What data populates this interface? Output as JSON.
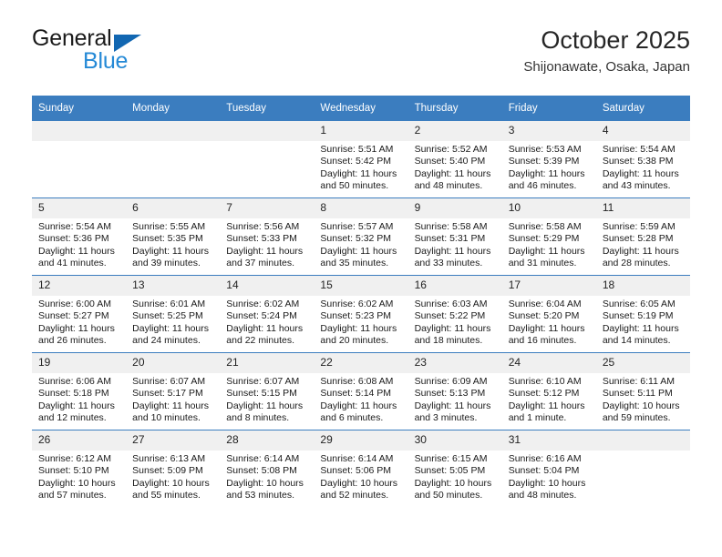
{
  "brand": {
    "name_top": "General",
    "name_bottom": "Blue",
    "accent_color": "#2489d6",
    "triangle_color": "#1267b2"
  },
  "header": {
    "title": "October 2025",
    "subtitle": "Shijonawate, Osaka, Japan"
  },
  "calendar": {
    "header_bg": "#3b7dbf",
    "daynum_bg": "#f0f0f0",
    "weekdays": [
      "Sunday",
      "Monday",
      "Tuesday",
      "Wednesday",
      "Thursday",
      "Friday",
      "Saturday"
    ],
    "labels": {
      "sunrise": "Sunrise:",
      "sunset": "Sunset:",
      "daylight": "Daylight:"
    },
    "weeks": [
      [
        {
          "day": "",
          "empty": true
        },
        {
          "day": "",
          "empty": true
        },
        {
          "day": "",
          "empty": true
        },
        {
          "day": "1",
          "sunrise": "Sunrise: 5:51 AM",
          "sunset": "Sunset: 5:42 PM",
          "daylight": "Daylight: 11 hours and 50 minutes."
        },
        {
          "day": "2",
          "sunrise": "Sunrise: 5:52 AM",
          "sunset": "Sunset: 5:40 PM",
          "daylight": "Daylight: 11 hours and 48 minutes."
        },
        {
          "day": "3",
          "sunrise": "Sunrise: 5:53 AM",
          "sunset": "Sunset: 5:39 PM",
          "daylight": "Daylight: 11 hours and 46 minutes."
        },
        {
          "day": "4",
          "sunrise": "Sunrise: 5:54 AM",
          "sunset": "Sunset: 5:38 PM",
          "daylight": "Daylight: 11 hours and 43 minutes."
        }
      ],
      [
        {
          "day": "5",
          "sunrise": "Sunrise: 5:54 AM",
          "sunset": "Sunset: 5:36 PM",
          "daylight": "Daylight: 11 hours and 41 minutes."
        },
        {
          "day": "6",
          "sunrise": "Sunrise: 5:55 AM",
          "sunset": "Sunset: 5:35 PM",
          "daylight": "Daylight: 11 hours and 39 minutes."
        },
        {
          "day": "7",
          "sunrise": "Sunrise: 5:56 AM",
          "sunset": "Sunset: 5:33 PM",
          "daylight": "Daylight: 11 hours and 37 minutes."
        },
        {
          "day": "8",
          "sunrise": "Sunrise: 5:57 AM",
          "sunset": "Sunset: 5:32 PM",
          "daylight": "Daylight: 11 hours and 35 minutes."
        },
        {
          "day": "9",
          "sunrise": "Sunrise: 5:58 AM",
          "sunset": "Sunset: 5:31 PM",
          "daylight": "Daylight: 11 hours and 33 minutes."
        },
        {
          "day": "10",
          "sunrise": "Sunrise: 5:58 AM",
          "sunset": "Sunset: 5:29 PM",
          "daylight": "Daylight: 11 hours and 31 minutes."
        },
        {
          "day": "11",
          "sunrise": "Sunrise: 5:59 AM",
          "sunset": "Sunset: 5:28 PM",
          "daylight": "Daylight: 11 hours and 28 minutes."
        }
      ],
      [
        {
          "day": "12",
          "sunrise": "Sunrise: 6:00 AM",
          "sunset": "Sunset: 5:27 PM",
          "daylight": "Daylight: 11 hours and 26 minutes."
        },
        {
          "day": "13",
          "sunrise": "Sunrise: 6:01 AM",
          "sunset": "Sunset: 5:25 PM",
          "daylight": "Daylight: 11 hours and 24 minutes."
        },
        {
          "day": "14",
          "sunrise": "Sunrise: 6:02 AM",
          "sunset": "Sunset: 5:24 PM",
          "daylight": "Daylight: 11 hours and 22 minutes."
        },
        {
          "day": "15",
          "sunrise": "Sunrise: 6:02 AM",
          "sunset": "Sunset: 5:23 PM",
          "daylight": "Daylight: 11 hours and 20 minutes."
        },
        {
          "day": "16",
          "sunrise": "Sunrise: 6:03 AM",
          "sunset": "Sunset: 5:22 PM",
          "daylight": "Daylight: 11 hours and 18 minutes."
        },
        {
          "day": "17",
          "sunrise": "Sunrise: 6:04 AM",
          "sunset": "Sunset: 5:20 PM",
          "daylight": "Daylight: 11 hours and 16 minutes."
        },
        {
          "day": "18",
          "sunrise": "Sunrise: 6:05 AM",
          "sunset": "Sunset: 5:19 PM",
          "daylight": "Daylight: 11 hours and 14 minutes."
        }
      ],
      [
        {
          "day": "19",
          "sunrise": "Sunrise: 6:06 AM",
          "sunset": "Sunset: 5:18 PM",
          "daylight": "Daylight: 11 hours and 12 minutes."
        },
        {
          "day": "20",
          "sunrise": "Sunrise: 6:07 AM",
          "sunset": "Sunset: 5:17 PM",
          "daylight": "Daylight: 11 hours and 10 minutes."
        },
        {
          "day": "21",
          "sunrise": "Sunrise: 6:07 AM",
          "sunset": "Sunset: 5:15 PM",
          "daylight": "Daylight: 11 hours and 8 minutes."
        },
        {
          "day": "22",
          "sunrise": "Sunrise: 6:08 AM",
          "sunset": "Sunset: 5:14 PM",
          "daylight": "Daylight: 11 hours and 6 minutes."
        },
        {
          "day": "23",
          "sunrise": "Sunrise: 6:09 AM",
          "sunset": "Sunset: 5:13 PM",
          "daylight": "Daylight: 11 hours and 3 minutes."
        },
        {
          "day": "24",
          "sunrise": "Sunrise: 6:10 AM",
          "sunset": "Sunset: 5:12 PM",
          "daylight": "Daylight: 11 hours and 1 minute."
        },
        {
          "day": "25",
          "sunrise": "Sunrise: 6:11 AM",
          "sunset": "Sunset: 5:11 PM",
          "daylight": "Daylight: 10 hours and 59 minutes."
        }
      ],
      [
        {
          "day": "26",
          "sunrise": "Sunrise: 6:12 AM",
          "sunset": "Sunset: 5:10 PM",
          "daylight": "Daylight: 10 hours and 57 minutes."
        },
        {
          "day": "27",
          "sunrise": "Sunrise: 6:13 AM",
          "sunset": "Sunset: 5:09 PM",
          "daylight": "Daylight: 10 hours and 55 minutes."
        },
        {
          "day": "28",
          "sunrise": "Sunrise: 6:14 AM",
          "sunset": "Sunset: 5:08 PM",
          "daylight": "Daylight: 10 hours and 53 minutes."
        },
        {
          "day": "29",
          "sunrise": "Sunrise: 6:14 AM",
          "sunset": "Sunset: 5:06 PM",
          "daylight": "Daylight: 10 hours and 52 minutes."
        },
        {
          "day": "30",
          "sunrise": "Sunrise: 6:15 AM",
          "sunset": "Sunset: 5:05 PM",
          "daylight": "Daylight: 10 hours and 50 minutes."
        },
        {
          "day": "31",
          "sunrise": "Sunrise: 6:16 AM",
          "sunset": "Sunset: 5:04 PM",
          "daylight": "Daylight: 10 hours and 48 minutes."
        },
        {
          "day": "",
          "empty": true
        }
      ]
    ]
  }
}
